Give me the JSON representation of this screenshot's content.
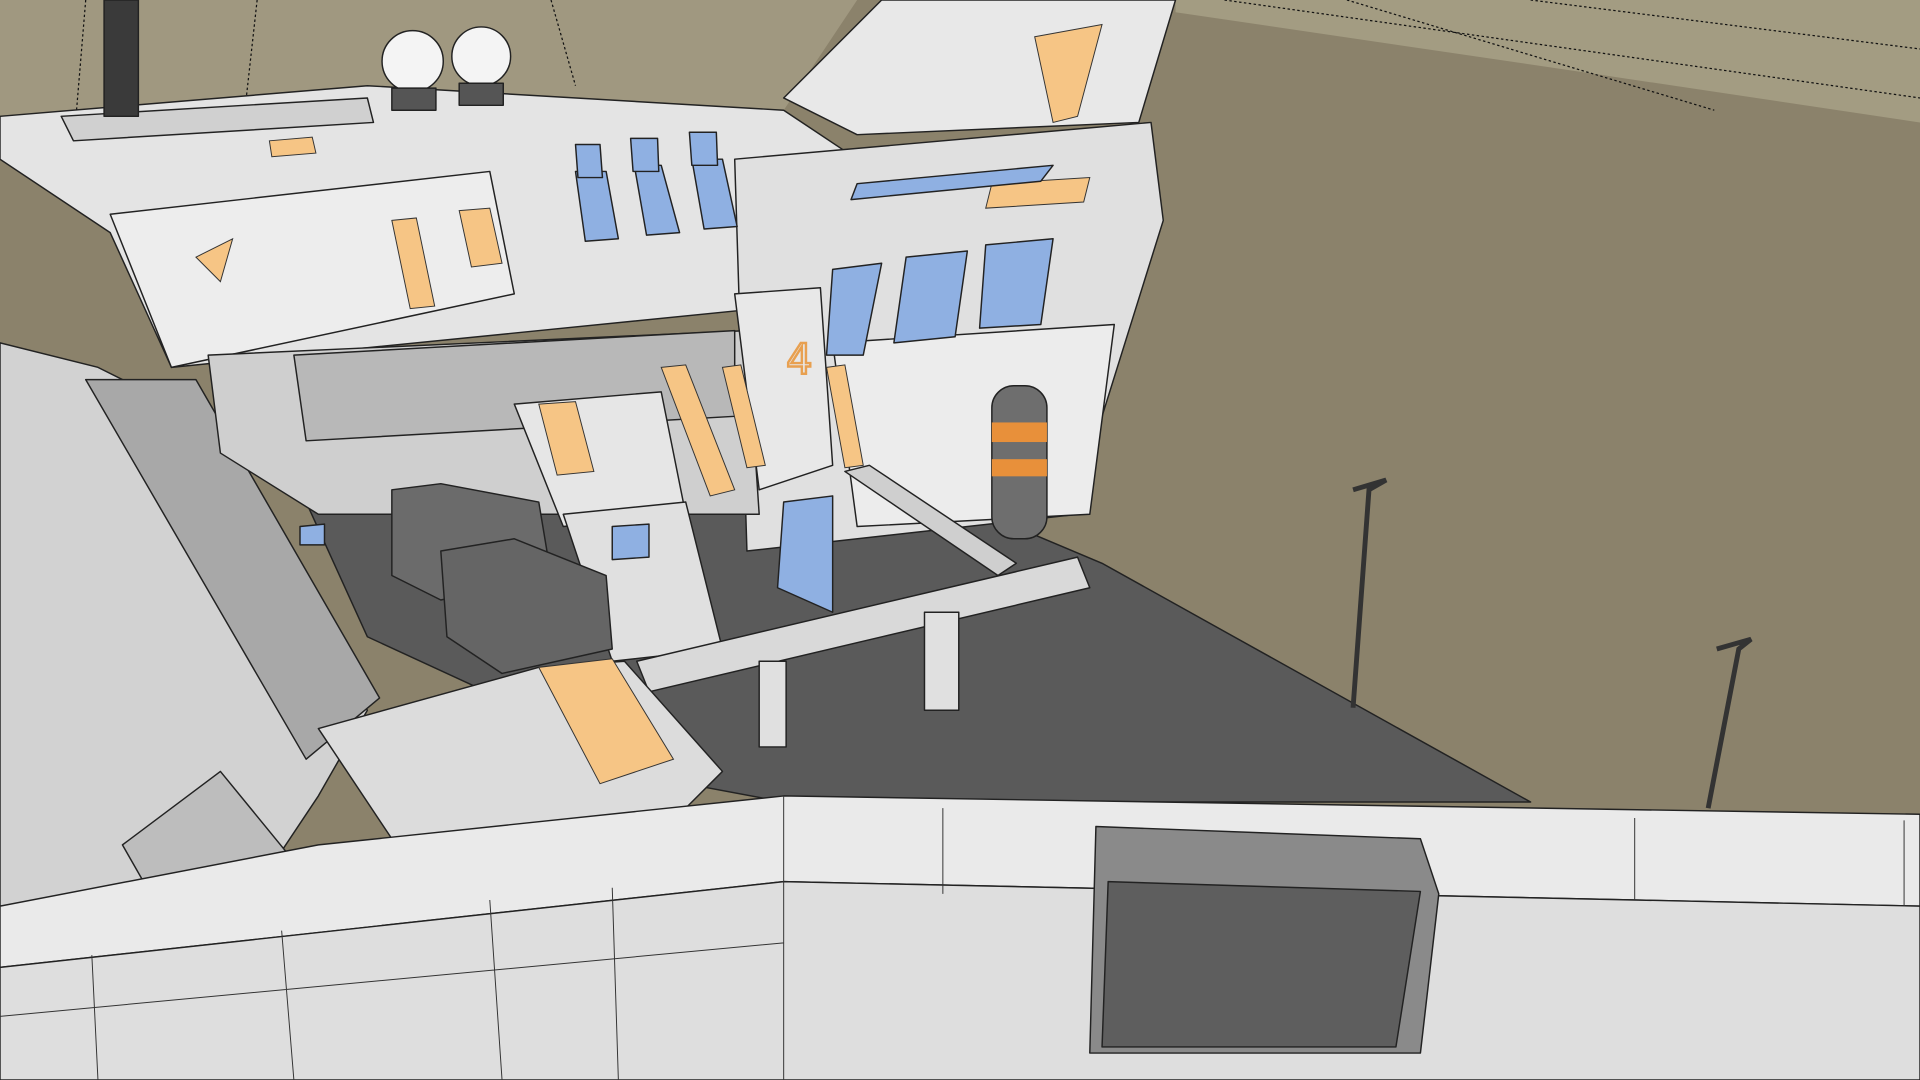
{
  "scene": {
    "painted_marking": "4",
    "colors": {
      "terrain": "#8b826b",
      "terrain_far": "#a39c82",
      "floor": "#5a5a5a",
      "hull_light": "#e6e6e6",
      "hull_mid": "#c8c8c8",
      "hull_shadow": "#9a9a9a",
      "accent_orange": "#f6c585",
      "glass_blue": "#8fb0e2",
      "machinery": "#6a6a6a"
    }
  }
}
